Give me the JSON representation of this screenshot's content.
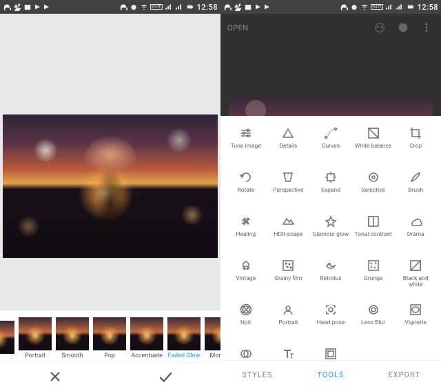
{
  "status": {
    "time": "12:58",
    "volte": "VoLTE"
  },
  "left": {
    "filters": [
      {
        "label": "",
        "active": false
      },
      {
        "label": "Portrait",
        "active": false
      },
      {
        "label": "Smooth",
        "active": false
      },
      {
        "label": "Pop",
        "active": false
      },
      {
        "label": "Accentuate",
        "active": false
      },
      {
        "label": "Faded Glow",
        "active": true
      },
      {
        "label": "Morning",
        "active": false
      }
    ]
  },
  "right": {
    "open_label": "OPEN",
    "tools": [
      {
        "label": "Tune image",
        "icon": "tune"
      },
      {
        "label": "Details",
        "icon": "details"
      },
      {
        "label": "Curves",
        "icon": "curves"
      },
      {
        "label": "White balance",
        "icon": "whitebalance"
      },
      {
        "label": "Crop",
        "icon": "crop"
      },
      {
        "label": "Rotate",
        "icon": "rotate"
      },
      {
        "label": "Perspective",
        "icon": "perspective"
      },
      {
        "label": "Expand",
        "icon": "expand"
      },
      {
        "label": "Selective",
        "icon": "selective"
      },
      {
        "label": "Brush",
        "icon": "brush"
      },
      {
        "label": "Healing",
        "icon": "healing"
      },
      {
        "label": "HDR-scape",
        "icon": "hdr"
      },
      {
        "label": "Glamour glow",
        "icon": "glamour"
      },
      {
        "label": "Tonal contrast",
        "icon": "tonal"
      },
      {
        "label": "Drama",
        "icon": "drama"
      },
      {
        "label": "Vintage",
        "icon": "vintage"
      },
      {
        "label": "Grainy film",
        "icon": "grainy"
      },
      {
        "label": "Retrolux",
        "icon": "retrolux"
      },
      {
        "label": "Grunge",
        "icon": "grunge"
      },
      {
        "label": "Black and white",
        "icon": "bw"
      },
      {
        "label": "Noir",
        "icon": "noir"
      },
      {
        "label": "Portrait",
        "icon": "portrait"
      },
      {
        "label": "Head pose",
        "icon": "headpose"
      },
      {
        "label": "Lens Blur",
        "icon": "lensblur"
      },
      {
        "label": "Vignette",
        "icon": "vignette"
      },
      {
        "label": "Double Exposure",
        "icon": "double"
      },
      {
        "label": "Text",
        "icon": "text"
      },
      {
        "label": "Frames",
        "icon": "frames"
      }
    ],
    "nav": {
      "styles": "STYLES",
      "tools": "TOOLS",
      "export": "EXPORT"
    }
  }
}
